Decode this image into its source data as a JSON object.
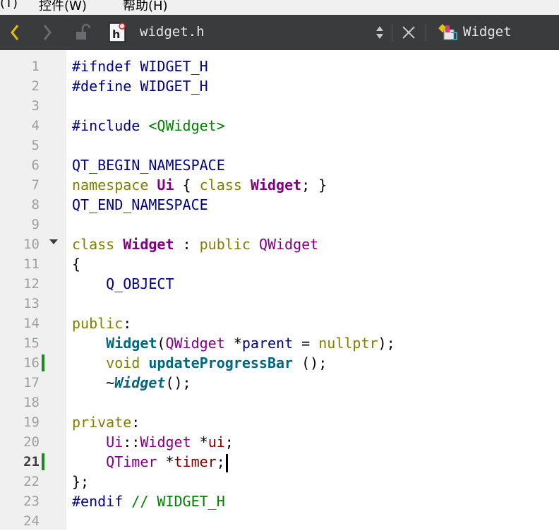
{
  "menubar": {
    "items": [
      "(T)",
      "控件(W)",
      "帮助(H)"
    ]
  },
  "toolbar": {
    "file_name": "widget.h",
    "symbol": "Widget"
  },
  "editor": {
    "current_line": 21,
    "line_numbers": [
      "1",
      "2",
      "3",
      "4",
      "5",
      "6",
      "7",
      "8",
      "9",
      "10",
      "11",
      "12",
      "13",
      "14",
      "15",
      "16",
      "17",
      "18",
      "19",
      "20",
      "21",
      "22",
      "23",
      "24"
    ],
    "changed_lines": [
      16,
      21
    ],
    "lines": [
      [
        "#ifndef",
        " ",
        "WIDGET_H"
      ],
      [
        "#define",
        " ",
        "WIDGET_H"
      ],
      [],
      [
        "#include",
        " ",
        "<QWidget>"
      ],
      [],
      [
        "QT_BEGIN_NAMESPACE"
      ],
      [
        "namespace",
        " ",
        "Ui",
        " { ",
        "class",
        " ",
        "Widget",
        "; }"
      ],
      [
        "QT_END_NAMESPACE"
      ],
      [],
      [
        "class",
        " ",
        "Widget",
        " : ",
        "public",
        " ",
        "QWidget"
      ],
      [
        "{"
      ],
      [
        "    ",
        "Q_OBJECT"
      ],
      [],
      [
        "public",
        ":"
      ],
      [
        "    ",
        "Widget",
        "(",
        "QWidget",
        " *",
        "parent",
        " = ",
        "nullptr",
        ");"
      ],
      [
        "    ",
        "void",
        " ",
        "updateProgressBar",
        " ();"
      ],
      [
        "    ~",
        "Widget",
        "();"
      ],
      [],
      [
        "private",
        ":"
      ],
      [
        "    ",
        "Ui",
        "::",
        "Widget",
        " *",
        "ui",
        ";"
      ],
      [
        "    ",
        "QTimer",
        " *",
        "timer",
        ";"
      ],
      [
        "};"
      ],
      [
        "#endif",
        " ",
        "// WIDGET_H"
      ],
      []
    ]
  }
}
